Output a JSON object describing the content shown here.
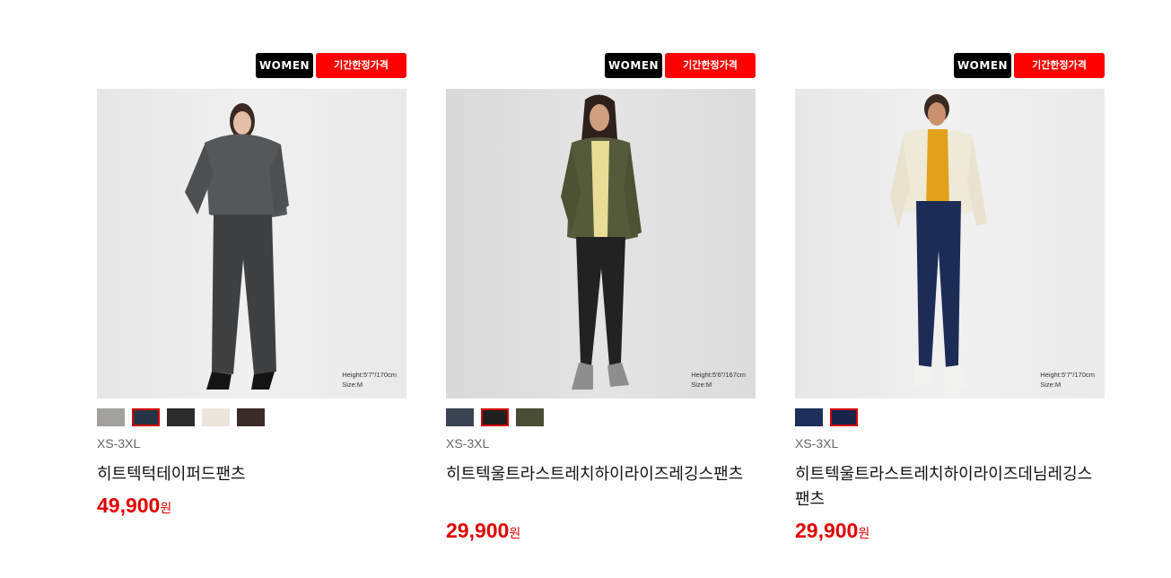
{
  "products": [
    {
      "badges": {
        "gender": "WOMEN",
        "promo": "기간한정가격"
      },
      "model_info": {
        "height": "Height:5'7\"/170cm",
        "size": "Size:M"
      },
      "swatch_colors": [
        "#a3a19e",
        "#273447",
        "#2b2b2b",
        "#ebe6dd",
        "#3a2c28"
      ],
      "selected_swatch": 1,
      "size_range": "XS-3XL",
      "name": "히트텍턱테이퍼드팬츠",
      "price": "49,900",
      "currency": "원"
    },
    {
      "badges": {
        "gender": "WOMEN",
        "promo": "기간한정가격"
      },
      "model_info": {
        "height": "Height:5'6\"/167cm",
        "size": "Size:M"
      },
      "swatch_colors": [
        "#3a4352",
        "#1f1f1f",
        "#4a4d36"
      ],
      "selected_swatch": 1,
      "size_range": "XS-3XL",
      "name": "히트텍울트라스트레치하이라이즈레깅스팬츠",
      "price": "29,900",
      "currency": "원"
    },
    {
      "badges": {
        "gender": "WOMEN",
        "promo": "기간한정가격"
      },
      "model_info": {
        "height": "Height:5'7\"/170cm",
        "size": "Size:M"
      },
      "swatch_colors": [
        "#1d2f5a",
        "#18244a"
      ],
      "selected_swatch": 1,
      "size_range": "XS-3XL",
      "name": "히트텍울트라스트레치하이라이즈데님레깅스팬츠",
      "price": "29,900",
      "currency": "원"
    }
  ]
}
